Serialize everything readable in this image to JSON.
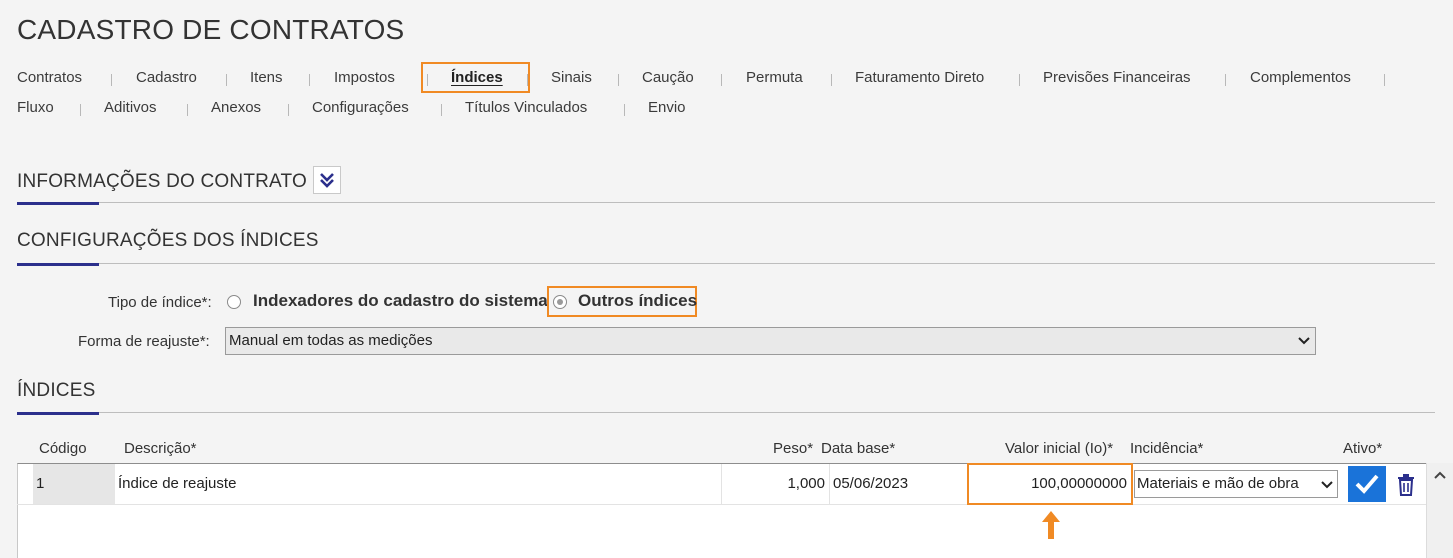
{
  "page": {
    "title": "CADASTRO DE CONTRATOS"
  },
  "nav": {
    "row1": [
      "Contratos",
      "Cadastro",
      "Itens",
      "Impostos",
      "Índices",
      "Sinais",
      "Caução",
      "Permuta",
      "Faturamento Direto",
      "Previsões Financeiras",
      "Complementos"
    ],
    "row2": [
      "Fluxo",
      "Aditivos",
      "Anexos",
      "Configurações",
      "Títulos Vinculados",
      "Envio"
    ],
    "active": "Índices"
  },
  "sections": {
    "info": "INFORMAÇÕES DO CONTRATO",
    "config": "CONFIGURAÇÕES DOS ÍNDICES",
    "indices": "ÍNDICES"
  },
  "form": {
    "tipo_label": "Tipo de índice*:",
    "tipo_options": [
      "Indexadores do cadastro do sistema",
      "Outros índices"
    ],
    "tipo_selected": "Outros índices",
    "forma_label": "Forma de reajuste*:",
    "forma_value": "Manual em todas as medições"
  },
  "table": {
    "headers": {
      "codigo": "Código",
      "descricao": "Descrição*",
      "peso": "Peso*",
      "data_base": "Data base*",
      "valor_inicial": "Valor inicial (Io)*",
      "incidencia": "Incidência*",
      "ativo": "Ativo*"
    },
    "rows": [
      {
        "codigo": "1",
        "descricao": "Índice de reajuste",
        "peso": "1,000",
        "data_base": "05/06/2023",
        "valor_inicial": "100,00000000",
        "incidencia": "Materiais e mão de obra",
        "ativo": true
      }
    ]
  },
  "colors": {
    "accent": "#2b2f8c",
    "highlight": "#f08a24",
    "check": "#1a73d9"
  }
}
